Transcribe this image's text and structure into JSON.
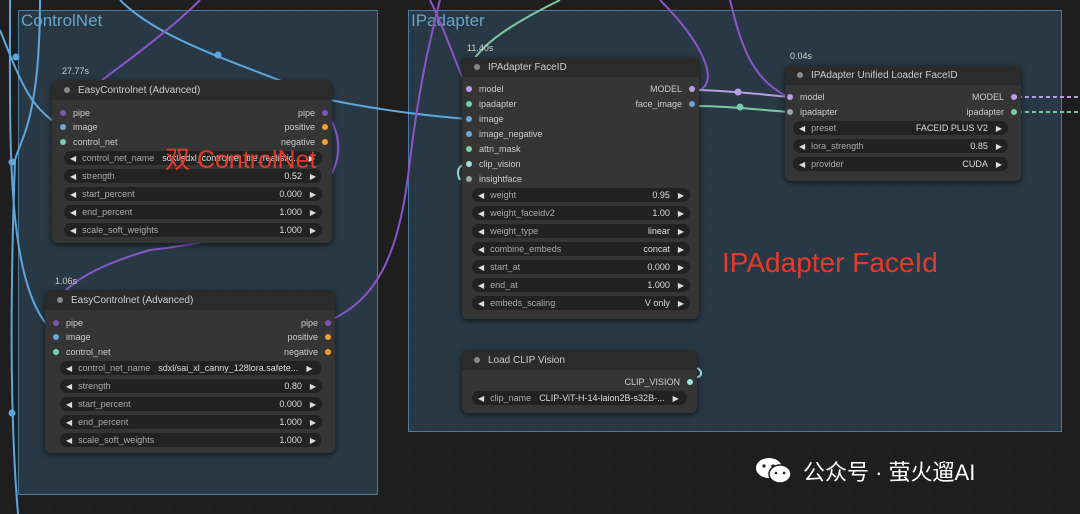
{
  "colors": {
    "pipe": "#7c55b8",
    "image": "#6aa9dc",
    "control_net": "#77d0a6",
    "positive": "#f0a030",
    "negative": "#f0a030",
    "model": "#b69fe3",
    "face_image": "#6aa9dc",
    "ipadapter": "#77d0a6",
    "clip_vision": "#9ce4e0",
    "insightface": "#9aa",
    "wire_purple": "#8b55c9",
    "wire_blue": "#5ea6db",
    "wire_green": "#7cc8a4",
    "overlay_red": "#e53a2a"
  },
  "groups": {
    "controlnet": "ControlNet",
    "ipadapter": "IPadapter"
  },
  "node_cn1": {
    "time": "27.77s",
    "title": "EasyControlnet (Advanced)",
    "inputs": [
      "pipe",
      "image",
      "control_net"
    ],
    "outputs": [
      "pipe",
      "positive",
      "negative"
    ],
    "widgets": [
      {
        "label": "control_net_name",
        "value": "sdxl/sdxl_controlnet_tile_realistic..."
      },
      {
        "label": "strength",
        "value": "0.52"
      },
      {
        "label": "start_percent",
        "value": "0.000"
      },
      {
        "label": "end_percent",
        "value": "1.000"
      },
      {
        "label": "scale_soft_weights",
        "value": "1.000"
      }
    ]
  },
  "node_cn2": {
    "time": "1.06s",
    "title": "EasyControlnet (Advanced)",
    "inputs": [
      "pipe",
      "image",
      "control_net"
    ],
    "outputs": [
      "pipe",
      "positive",
      "negative"
    ],
    "widgets": [
      {
        "label": "control_net_name",
        "value": "sdxl/sai_xl_canny_128lora.safete..."
      },
      {
        "label": "strength",
        "value": "0.80"
      },
      {
        "label": "start_percent",
        "value": "0.000"
      },
      {
        "label": "end_percent",
        "value": "1.000"
      },
      {
        "label": "scale_soft_weights",
        "value": "1.000"
      }
    ]
  },
  "node_ipa": {
    "time": "11.40s",
    "title": "IPAdapter FaceID",
    "inputs": [
      "model",
      "ipadapter",
      "image",
      "image_negative",
      "attn_mask",
      "clip_vision",
      "insightface"
    ],
    "outputs": [
      "MODEL",
      "face_image"
    ],
    "widgets": [
      {
        "label": "weight",
        "value": "0.95"
      },
      {
        "label": "weight_faceidv2",
        "value": "1.00"
      },
      {
        "label": "weight_type",
        "value": "linear"
      },
      {
        "label": "combine_embeds",
        "value": "concat"
      },
      {
        "label": "start_at",
        "value": "0.000"
      },
      {
        "label": "end_at",
        "value": "1.000"
      },
      {
        "label": "embeds_scaling",
        "value": "V only"
      }
    ]
  },
  "node_loader": {
    "time": "0.04s",
    "title": "IPAdapter Unified Loader FaceID",
    "inputs": [
      "model",
      "ipadapter"
    ],
    "outputs": [
      "MODEL",
      "ipadapter"
    ],
    "widgets": [
      {
        "label": "preset",
        "value": "FACEID PLUS V2"
      },
      {
        "label": "lora_strength",
        "value": "0.85"
      },
      {
        "label": "provider",
        "value": "CUDA"
      }
    ]
  },
  "node_clip": {
    "title": "Load CLIP Vision",
    "outputs": [
      "CLIP_VISION"
    ],
    "widgets": [
      {
        "label": "clip_name",
        "value": "CLIP-ViT-H-14-laion2B-s32B-..."
      }
    ]
  },
  "overlays": {
    "dual": "双 ControlNet",
    "faceid": "IPAdapter FaceId"
  },
  "watermark": "公众号 · 萤火遛AI"
}
